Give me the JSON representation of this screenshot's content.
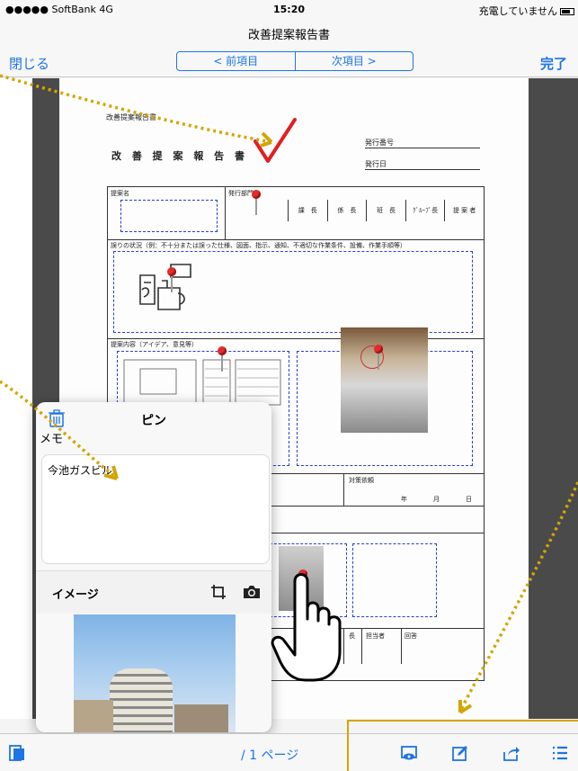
{
  "status_bar": {
    "carrier": "●●●●● SoftBank 4G",
    "time": "15:20",
    "battery_text": "充電していません"
  },
  "nav": {
    "title": "改善提案報告書",
    "close_label": "閉じる",
    "done_label": "完了",
    "prev_label": "< 前項目",
    "next_label": "次項目 >"
  },
  "document": {
    "header_small": "改善提案報告書",
    "title": "改 善 提 案 報 告 書",
    "issue_no_label": "発行番号",
    "issue_date_label": "発行日",
    "proposal_name_label": "提案名",
    "issuing_dept_label": "発行部門",
    "approvals": [
      "課　長",
      "係　長",
      "班　長",
      "ｸﾞﾙｰﾌﾟ長",
      "提 案 者"
    ],
    "situation_label": "誤りの状況（例：不十分または誤った仕様、図面、指示、通知、不適切な作業条件、設備、作業手順等）",
    "proposal_content_label": "提案内容（アイデア、意見等）",
    "countermeasure_label": "対策依頼",
    "date_units": [
      "年",
      "月",
      "日"
    ],
    "bottom_cols": [
      "長",
      "担当者",
      "回答"
    ]
  },
  "popover": {
    "title": "ピン",
    "memo_label": "メモ",
    "memo_text": "今池ガスビル",
    "image_label": "イメージ"
  },
  "toolbar": {
    "page_label": "/ 1 ページ"
  },
  "colors": {
    "accent": "#1d74e6",
    "annotation": "#d4a500",
    "pin": "#e32b2b",
    "dashed_field": "#2b3bd8"
  }
}
